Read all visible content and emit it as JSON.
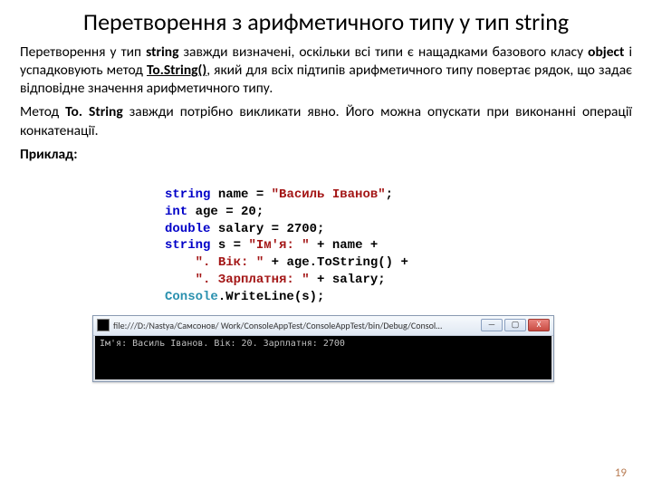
{
  "title": "Перетворення з арифметичного типу у тип string",
  "para1": {
    "t1": "Перетворення у тип ",
    "b1": "string",
    "t2": " завжди визначені, оскільки всі типи є нащадками базового класу ",
    "b2": "object",
    "t3": " і успадковують метод ",
    "b3": "To.String()",
    "t4": ", який для всіх підтипів арифметичного типу повертає рядок, що задає відповідне значення арифметичного типу."
  },
  "para2": {
    "t1": "Метод ",
    "b1": "To. String",
    "t2": " завжди потрібно викликати явно. Його можна опускати при виконанні операції конкатенації."
  },
  "example_label": "Приклад:",
  "code": {
    "l1": {
      "kw": "string",
      "rest": " name = ",
      "str": "\"Василь Іванов\"",
      "end": ";"
    },
    "l2": {
      "kw": "int",
      "rest": " age = ",
      "num": "20",
      "end": ";"
    },
    "l3": {
      "kw": "double",
      "rest": " salary = ",
      "num": "2700",
      "end": ";"
    },
    "l4": {
      "kw": "string",
      "rest": " s = ",
      "str": "\"Ім'я: \"",
      "mid": " + name +"
    },
    "l5": {
      "str": "\". Вік: \"",
      "mid": " + age.ToString() +"
    },
    "l6": {
      "str": "\". Зарплатня: \"",
      "mid": " + salary;"
    },
    "l7": {
      "cls": "Console",
      "rest": ".WriteLine(s);"
    }
  },
  "window": {
    "title": "file:///D:/Nastya/Самсонов/ Work/ConsoleAppTest/ConsoleAppTest/bin/Debug/Consol…",
    "btn_min": "—",
    "btn_max": "▢",
    "btn_close": "X",
    "output": "Ім'я: Василь Іванов. Вік: 20. Зарплатня: 2700"
  },
  "page_number": "19"
}
